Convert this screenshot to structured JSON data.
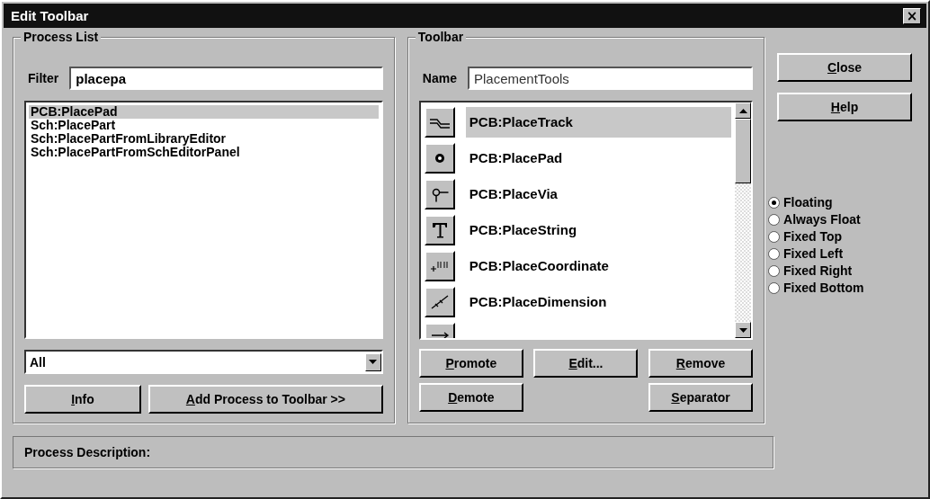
{
  "window": {
    "title": "Edit Toolbar",
    "close": "×"
  },
  "process_list": {
    "title": "Process List",
    "filter_label": "Filter",
    "filter_value": "placepa",
    "items": [
      {
        "label": "PCB:PlacePad",
        "selected": true
      },
      {
        "label": "Sch:PlacePart",
        "selected": false
      },
      {
        "label": "Sch:PlacePartFromLibraryEditor",
        "selected": false
      },
      {
        "label": "Sch:PlacePartFromSchEditorPanel",
        "selected": false
      }
    ],
    "dropdown": {
      "value": "All"
    },
    "buttons": [
      "Info",
      "Add Process to Toolbar >>"
    ]
  },
  "toolbar": {
    "title": "Toolbar",
    "name_label": "Name",
    "name_value": "PlacementTools",
    "items": [
      {
        "kind": "track",
        "label": "PCB:PlaceTrack",
        "selected": true
      },
      {
        "kind": "pad",
        "label": "PCB:PlacePad",
        "selected": false
      },
      {
        "kind": "via",
        "label": "PCB:PlaceVia",
        "selected": false
      },
      {
        "kind": "string",
        "label": "PCB:PlaceString",
        "selected": false
      },
      {
        "kind": "coordinate",
        "label": "PCB:PlaceCoordinate",
        "selected": false
      },
      {
        "kind": "dimension",
        "label": "PCB:PlaceDimension",
        "selected": false
      },
      {
        "kind": "arrow"
      }
    ],
    "buttons": [
      "Promote",
      "Edit...",
      "Remove",
      "Demote",
      "Separator"
    ]
  },
  "side_buttons": [
    "Close",
    "Help"
  ],
  "dock_options": [
    {
      "label": "Floating",
      "selected": true
    },
    {
      "label": "Always Float",
      "selected": false
    },
    {
      "label": "Fixed Top",
      "selected": false
    },
    {
      "label": "Fixed Left",
      "selected": false
    },
    {
      "label": "Fixed Right",
      "selected": false
    },
    {
      "label": "Fixed Bottom",
      "selected": false
    }
  ],
  "description": {
    "label": "Process Description:"
  }
}
